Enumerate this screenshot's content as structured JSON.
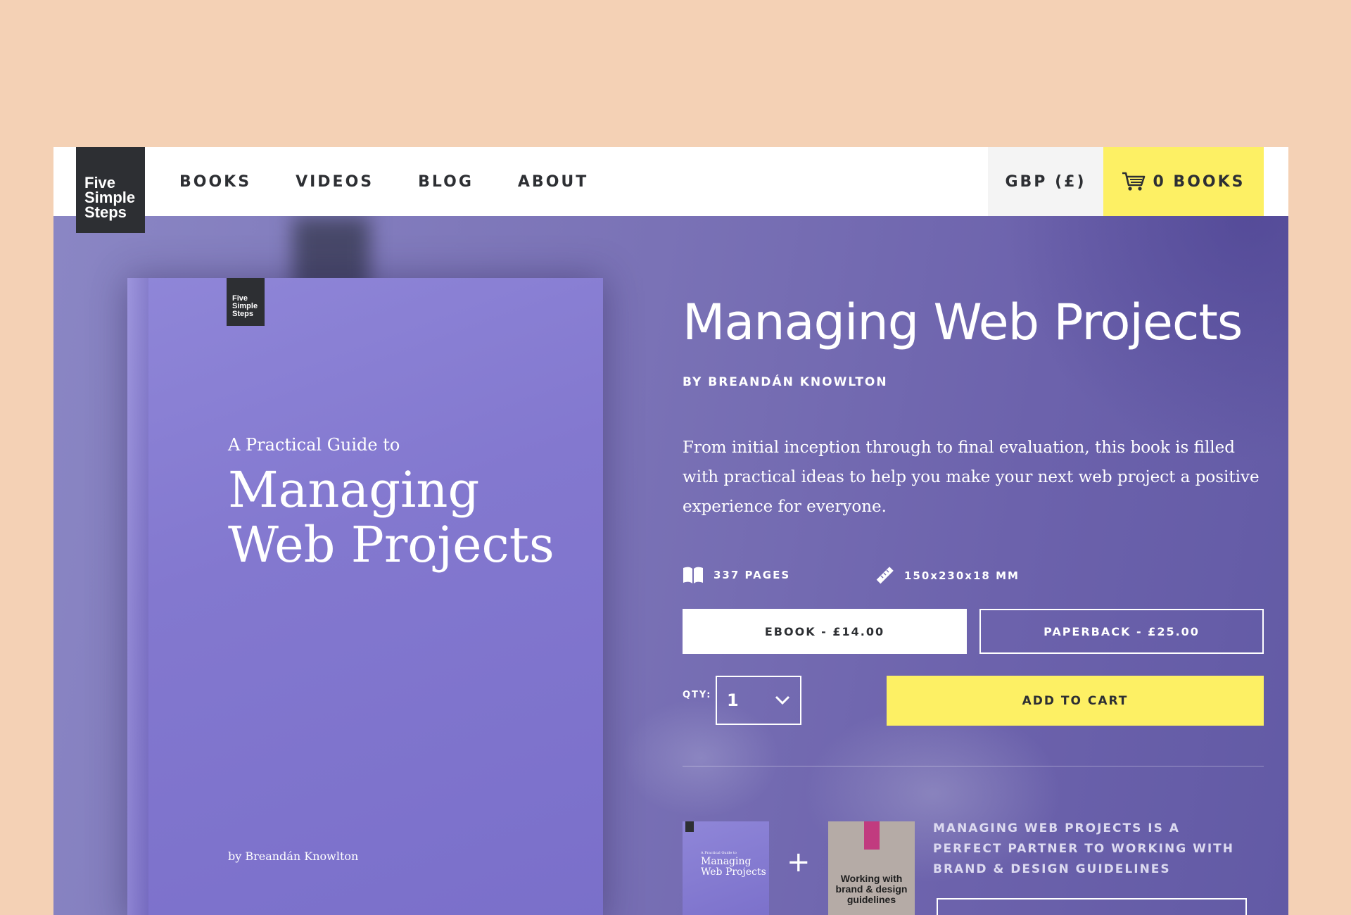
{
  "header": {
    "logo_lines": [
      "Five",
      "Simple",
      "Steps"
    ],
    "nav": [
      "BOOKS",
      "VIDEOS",
      "BLOG",
      "ABOUT"
    ],
    "currency": "GBP (£)",
    "cart_label": "0 BOOKS"
  },
  "book_cover": {
    "logo_lines": [
      "Five",
      "Simple",
      "Steps"
    ],
    "subtitle": "A Practical Guide to",
    "title_line1": "Managing",
    "title_line2": "Web Projects",
    "author": "by Breandán Knowlton"
  },
  "product": {
    "title": "Managing Web Projects",
    "byline": "BY BREANDÁN KNOWLTON",
    "description": "From initial inception through to final evaluation, this book is filled with practical ideas to help you make your next web project a positive experience for everyone.",
    "pages": "337 PAGES",
    "dimensions": "150x230x18 MM",
    "options": [
      "EBOOK - £14.00",
      "PAPERBACK - £25.00"
    ],
    "qty_label": "QTY:",
    "qty_value": "1",
    "add_to_cart": "ADD TO CART"
  },
  "bundle": {
    "thumb1_subtitle": "A Practical Guide to",
    "thumb1_title": "Managing Web Projects",
    "plus": "+",
    "thumb2_title": "Working with brand & design guidelines",
    "text": "MANAGING WEB PROJECTS IS A PERFECT PARTNER TO WORKING WITH BRAND & DESIGN GUIDELINES"
  },
  "colors": {
    "accent_yellow": "#fdf064",
    "dark": "#2d2f33",
    "hero_purple": "#7a72b6",
    "page_bg": "#f4d1b5"
  }
}
